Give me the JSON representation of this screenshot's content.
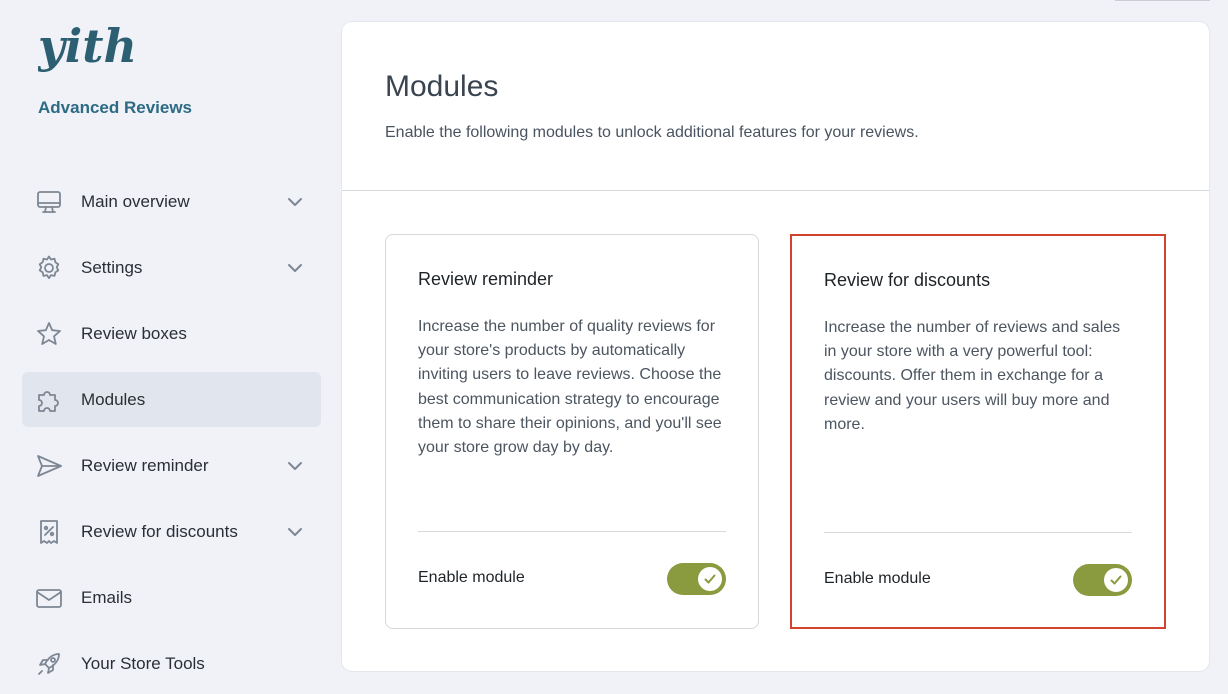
{
  "brand": {
    "logo_text": "yith",
    "plugin_name": "Advanced Reviews",
    "logo_color": "#2d5f73"
  },
  "sidebar": {
    "items": [
      {
        "label": "Main overview",
        "icon": "monitor-icon",
        "has_chevron": true,
        "active": false
      },
      {
        "label": "Settings",
        "icon": "gear-icon",
        "has_chevron": true,
        "active": false
      },
      {
        "label": "Review boxes",
        "icon": "star-icon",
        "has_chevron": false,
        "active": false
      },
      {
        "label": "Modules",
        "icon": "puzzle-icon",
        "has_chevron": false,
        "active": true
      },
      {
        "label": "Review reminder",
        "icon": "paper-plane-icon",
        "has_chevron": true,
        "active": false
      },
      {
        "label": "Review for discounts",
        "icon": "discount-receipt-icon",
        "has_chevron": true,
        "active": false
      },
      {
        "label": "Emails",
        "icon": "envelope-icon",
        "has_chevron": false,
        "active": false
      },
      {
        "label": "Your Store Tools",
        "icon": "rocket-icon",
        "has_chevron": false,
        "active": false
      }
    ]
  },
  "main": {
    "title": "Modules",
    "description": "Enable the following modules to unlock additional features for your reviews.",
    "modules": [
      {
        "title": "Review reminder",
        "text": "Increase the number of quality reviews for your store's products by automatically inviting users to leave reviews. Choose the best communication strategy to encourage them to share their opinions, and you'll see your store grow day by day.",
        "enable_label": "Enable module",
        "enabled": true
      },
      {
        "title": "Review for discounts",
        "text": "Increase the number of reviews and sales in your store with a very powerful tool: discounts. Offer them in exchange for a review and your users will buy more and more.",
        "enable_label": "Enable module",
        "enabled": true,
        "highlighted": true
      }
    ]
  },
  "colors": {
    "toggle_on": "#8a9a3e",
    "highlight_border": "#d2432f",
    "accent_text": "#2d6a84",
    "active_nav_bg": "#e1e5ed"
  }
}
